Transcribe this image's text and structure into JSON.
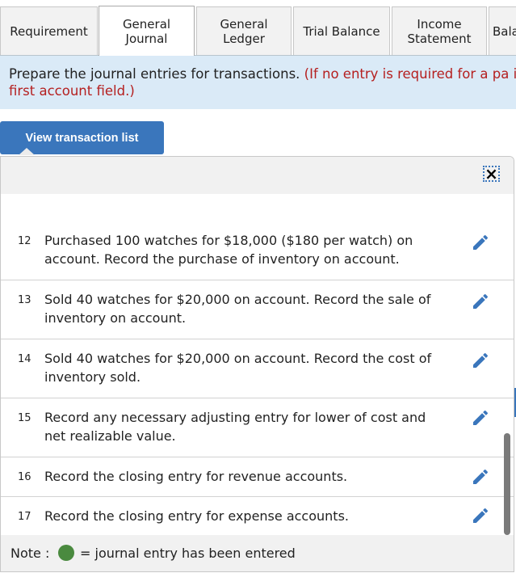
{
  "tabs": [
    {
      "label": "Requirement",
      "active": false
    },
    {
      "label": "General\nJournal",
      "active": true
    },
    {
      "label": "General\nLedger",
      "active": false
    },
    {
      "label": "Trial Balance",
      "active": false
    },
    {
      "label": "Income\nStatement",
      "active": false
    },
    {
      "label": "Bala",
      "active": false
    }
  ],
  "instructions": {
    "main": "Prepare the journal entries for transactions. ",
    "note": "(If no entry is required for a pa in the first account field.)"
  },
  "view_button": "View transaction list",
  "close_icon": "×",
  "transactions": [
    {
      "num": "12",
      "text": "Purchased 100 watches for $18,000 ($180 per watch) on account. Record the purchase of inventory on account."
    },
    {
      "num": "13",
      "text": "Sold 40 watches for $20,000 on account. Record the sale of inventory on account."
    },
    {
      "num": "14",
      "text": "Sold 40 watches for $20,000 on account. Record the cost of inventory sold."
    },
    {
      "num": "15",
      "text": "Record any necessary adjusting entry for lower of cost and net realizable value."
    },
    {
      "num": "16",
      "text": "Record the closing entry for revenue accounts."
    },
    {
      "num": "17",
      "text": "Record the closing entry for expense accounts."
    }
  ],
  "note": {
    "label": "Note :",
    "description": "= journal entry has been entered",
    "dot_color": "#4a8a3f"
  },
  "colors": {
    "accent": "#3a76bc",
    "instruction_bg": "#daeaf7",
    "warning_text": "#b52020"
  }
}
